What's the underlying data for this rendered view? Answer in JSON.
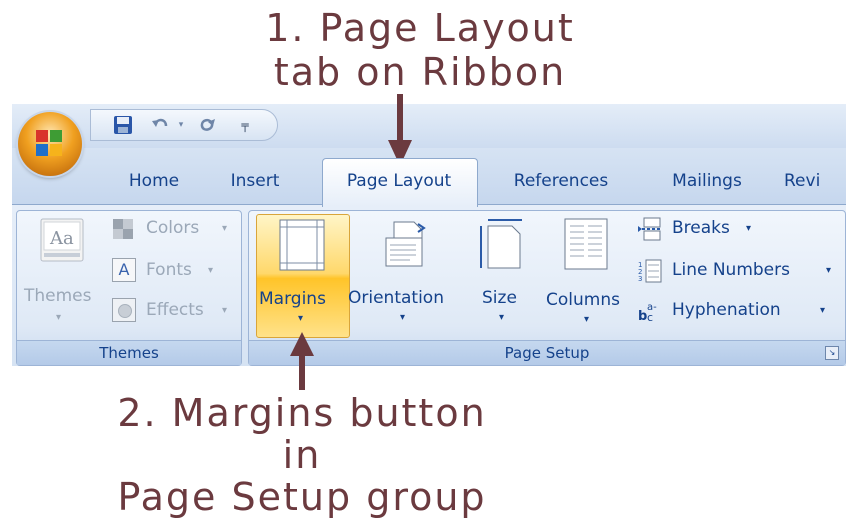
{
  "annotations": {
    "step1_line1": "1. Page Layout",
    "step1_line2": "tab on Ribbon",
    "step2_line1": "2. Margins button in",
    "step2_line2": "Page Setup group"
  },
  "quick_access": {
    "save": "save-icon",
    "undo": "undo-icon",
    "redo": "redo-icon",
    "customize": "customize-icon"
  },
  "tabs": [
    "Home",
    "Insert",
    "Page Layout",
    "References",
    "Mailings",
    "Revi"
  ],
  "active_tab": "Page Layout",
  "groups": {
    "themes": {
      "label": "Themes",
      "themes_button": "Themes",
      "colors": "Colors",
      "fonts": "Fonts",
      "effects": "Effects"
    },
    "page_setup": {
      "label": "Page Setup",
      "margins": "Margins",
      "orientation": "Orientation",
      "size": "Size",
      "columns": "Columns",
      "breaks": "Breaks",
      "line_numbers": "Line Numbers",
      "hyphenation": "Hyphenation"
    }
  },
  "colors": {
    "annotation": "#6b3a3f",
    "ribbon_text": "#15428b",
    "highlight": "#ffc429"
  }
}
